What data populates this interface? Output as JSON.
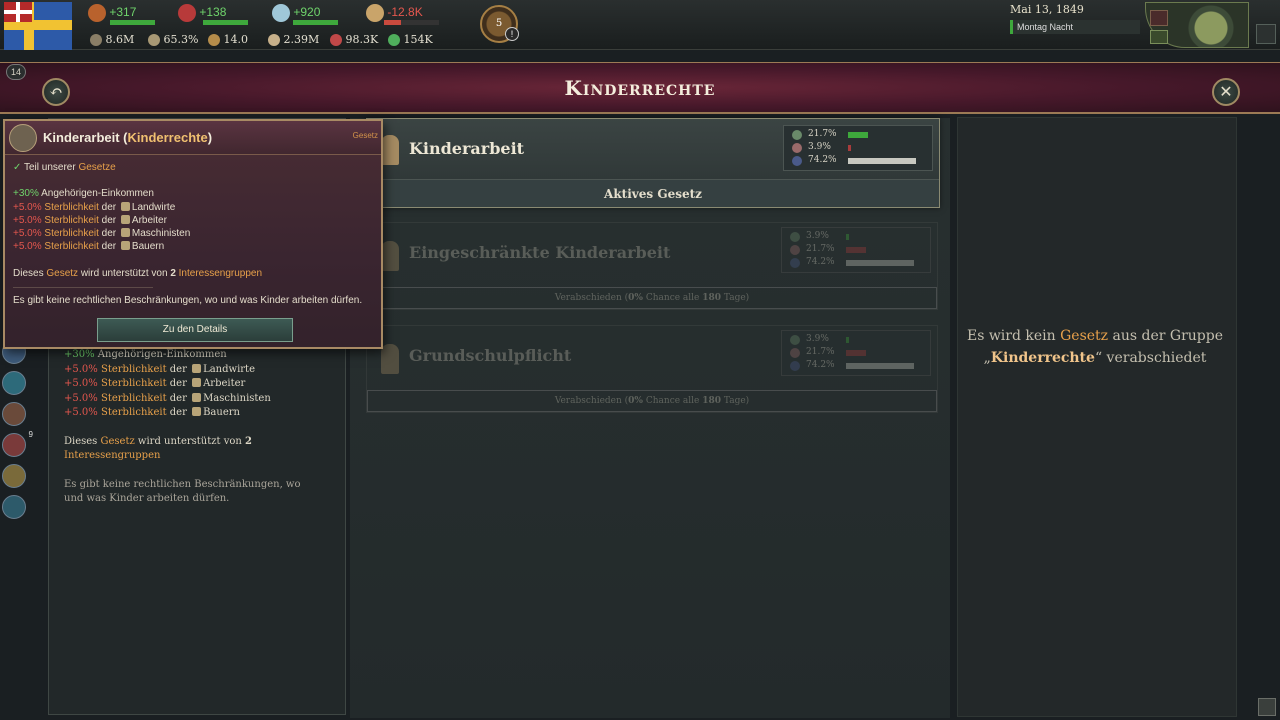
{
  "topbar": {
    "resources_top": [
      {
        "name": "authority",
        "value": "+317",
        "sign": "pos",
        "icon": "authority-icon"
      },
      {
        "name": "influence",
        "value": "+138",
        "sign": "pos",
        "icon": "influence-icon"
      },
      {
        "name": "bureaucracy",
        "value": "+920",
        "sign": "pos",
        "icon": "dove-icon"
      },
      {
        "name": "money",
        "value": "-12.8K",
        "sign": "neg",
        "icon": "pound-icon"
      }
    ],
    "stats_bottom": [
      "8.6M",
      "65.3%",
      "14.0",
      "2.39M",
      "98.3K",
      "154K"
    ],
    "emblem_number": "5",
    "alert_symbol": "!",
    "date": "Mai 13, 1849",
    "daytime": "Montag Nacht"
  },
  "header": {
    "title": "Kinderrechte",
    "level_badge": "14"
  },
  "laws": [
    {
      "name": "Kinderarbeit",
      "state": "active",
      "action": "Aktives Gesetz",
      "stats": [
        {
          "icon": "approve-icon",
          "value": "21.7%",
          "bar_fraction": 0.3,
          "color": "#3ea83c"
        },
        {
          "icon": "oppose-icon",
          "value": "3.9%",
          "bar_fraction": 0.05,
          "color": "#a83c3c"
        },
        {
          "icon": "neutral-icon",
          "value": "74.2%",
          "bar_fraction": 1.0,
          "color": "#c8c8c0"
        }
      ]
    },
    {
      "name": "Eingeschränkte Kinderarbeit",
      "state": "inactive",
      "action_pre": "Verabschieden (",
      "action_pct": "0%",
      "action_mid": " Chance alle ",
      "action_days": "180",
      "action_post": " Tage)",
      "stats": [
        {
          "icon": "approve-icon",
          "value": "3.9%",
          "bar_fraction": 0.05,
          "color": "#3ea83c"
        },
        {
          "icon": "oppose-icon",
          "value": "21.7%",
          "bar_fraction": 0.3,
          "color": "#a83c3c"
        },
        {
          "icon": "neutral-icon",
          "value": "74.2%",
          "bar_fraction": 1.0,
          "color": "#c8c8c0"
        }
      ]
    },
    {
      "name": "Grundschulpflicht",
      "state": "inactive",
      "action_pre": "Verabschieden (",
      "action_pct": "0%",
      "action_mid": " Chance alle ",
      "action_days": "180",
      "action_post": " Tage)",
      "stats": [
        {
          "icon": "approve-icon",
          "value": "3.9%",
          "bar_fraction": 0.05,
          "color": "#3ea83c"
        },
        {
          "icon": "oppose-icon",
          "value": "21.7%",
          "bar_fraction": 0.3,
          "color": "#a83c3c"
        },
        {
          "icon": "neutral-icon",
          "value": "74.2%",
          "bar_fraction": 1.0,
          "color": "#c8c8c0"
        }
      ]
    }
  ],
  "right_panel": {
    "pre": "Es wird kein ",
    "kw": "Gesetz",
    "mid": " aus der Gruppe",
    "quote_open": "„",
    "group": "Kinderrechte",
    "quote_close": "“",
    "post": " verabschiedet"
  },
  "effects": {
    "income": {
      "value": "+30%",
      "label": " Angehörigen-Einkommen"
    },
    "mortality": [
      {
        "value": "+5.0%",
        "kw": "Sterblichkeit",
        "der": " der ",
        "group": "Landwirte"
      },
      {
        "value": "+5.0%",
        "kw": "Sterblichkeit",
        "der": " der ",
        "group": "Arbeiter"
      },
      {
        "value": "+5.0%",
        "kw": "Sterblichkeit",
        "der": " der ",
        "group": "Maschinisten"
      },
      {
        "value": "+5.0%",
        "kw": "Sterblichkeit",
        "der": " der ",
        "group": "Bauern"
      }
    ],
    "support_pre": "Dieses ",
    "support_kw": "Gesetz",
    "support_mid": " wird unterstützt von ",
    "support_num": "2",
    "support_groups": " Interessengruppen",
    "description": "Es gibt keine rechtlichen Beschränkungen, wo und was Kinder arbeiten dürfen."
  },
  "tooltip": {
    "title_main": "Kinderarbeit (",
    "title_hl": "Kinderrechte",
    "title_end": ")",
    "tag": "Gesetz",
    "check_mark": "✓",
    "part_pre": " Teil unserer ",
    "part_kw": "Gesetze",
    "button": "Zu den Details"
  },
  "side_icons": [
    {
      "name": "side-1"
    },
    {
      "name": "side-2"
    },
    {
      "name": "side-3"
    },
    {
      "name": "side-4",
      "count": "9"
    },
    {
      "name": "side-5"
    },
    {
      "name": "side-6"
    }
  ]
}
